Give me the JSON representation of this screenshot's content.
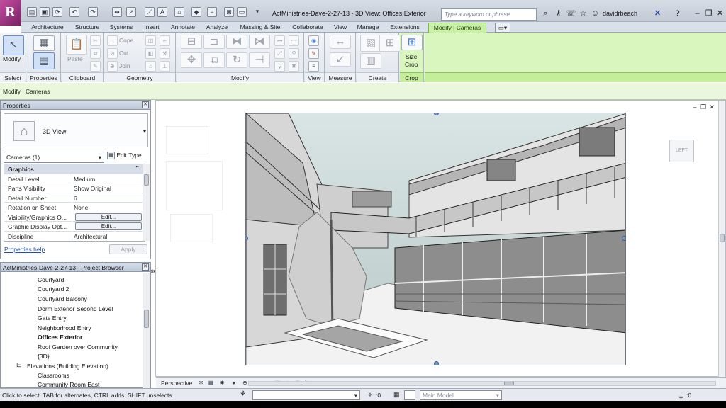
{
  "app": {
    "logo": "R",
    "title": "ActMinistries-Dave-2-27-13 - 3D View: Offices Exterior",
    "search_placeholder": "Type a keyword or phrase",
    "user": "davidrbeach",
    "qat_icons": [
      "open-icon",
      "save-icon",
      "sync-icon",
      "undo-icon",
      "redo-icon",
      "measure-icon",
      "dimension-icon",
      "text-icon",
      "3d-view-icon",
      "section-icon",
      "thin-lines-icon",
      "close-hidden-icon",
      "switch-windows-icon"
    ],
    "win_controls": [
      "–",
      "❐",
      "✕"
    ]
  },
  "tabs": [
    "Architecture",
    "Structure",
    "Systems",
    "Insert",
    "Annotate",
    "Analyze",
    "Massing & Site",
    "Collaborate",
    "View",
    "Manage",
    "Extensions",
    "Modify | Cameras"
  ],
  "ribbon": {
    "panels": {
      "select": "Select",
      "properties": "Properties",
      "clipboard": "Clipboard",
      "geometry": "Geometry",
      "modify": "Modify",
      "view": "View",
      "measure": "Measure",
      "create": "Create",
      "crop": "Crop"
    },
    "modify_label": "Modify",
    "paste_label": "Paste",
    "cope_label": "Cope",
    "cut_label": "Cut",
    "join_label": "Join",
    "size_crop_line1": "Size",
    "size_crop_line2": "Crop"
  },
  "options_bar": {
    "context": "Modify | Cameras"
  },
  "properties": {
    "title": "Properties",
    "type_name": "3D View",
    "instance_filter": "Cameras (1)",
    "edit_type": "Edit Type",
    "group": "Graphics",
    "rows": [
      {
        "k": "Detail Level",
        "v": "Medium"
      },
      {
        "k": "Parts Visibility",
        "v": "Show Original"
      },
      {
        "k": "Detail Number",
        "v": "6"
      },
      {
        "k": "Rotation on Sheet",
        "v": "None"
      },
      {
        "k": "Visibility/Graphics O...",
        "v": "Edit..."
      },
      {
        "k": "Graphic Display Opt...",
        "v": "Edit..."
      },
      {
        "k": "Discipline",
        "v": "Architectural"
      }
    ],
    "help_link": "Properties help",
    "apply": "Apply"
  },
  "browser": {
    "title": "ActMinistries-Dave-2-27-13 - Project Browser",
    "items": [
      "Courtyard",
      "Courtyard 2",
      "Courtyard Balcony",
      "Dorm Exterior Second Level",
      "Gate Entry",
      "Neighborhood Entry",
      "Offices Exterior",
      "Roof Garden over Community",
      "{3D}"
    ],
    "elevations": "Elevations (Building Elevation)",
    "elev_items": [
      "Classrooms",
      "Community Room East"
    ]
  },
  "view": {
    "cube_label": "LEFT",
    "controls": [
      "–",
      "❐",
      "✕"
    ],
    "bar_label": "Perspective",
    "bar_icons": [
      "✉",
      "▦",
      "✸",
      "●",
      "⊕",
      "⊖",
      "◐",
      "▣",
      "✦",
      "⊞",
      "❖",
      "⌂"
    ]
  },
  "status": {
    "message": "Click to select, TAB for alternates, CTRL adds, SHIFT unselects.",
    "selection_count": ":0",
    "model": "Main Model"
  }
}
